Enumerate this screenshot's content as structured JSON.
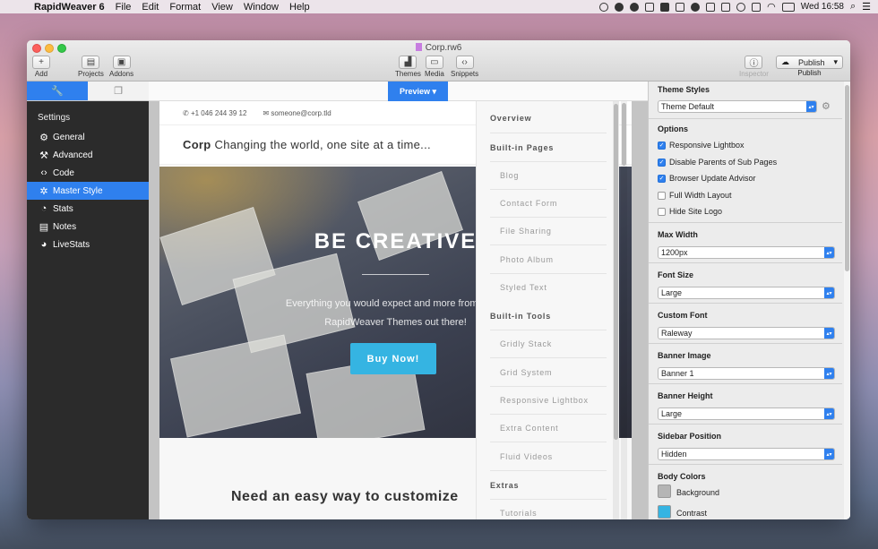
{
  "menubar": {
    "apple": "",
    "app": "RapidWeaver 6",
    "menus": [
      "File",
      "Edit",
      "Format",
      "View",
      "Window",
      "Help"
    ],
    "clock": "Wed 16:58"
  },
  "window": {
    "title": "Corp.rw6",
    "toolbar": {
      "add": "Add",
      "projects": "Projects",
      "addons": "Addons",
      "themes": "Themes",
      "media": "Media",
      "snippets": "Snippets",
      "inspector": "Inspector",
      "publish_button": "Publish",
      "publish_label": "Publish"
    }
  },
  "sidebar": {
    "section_label": "Settings",
    "items": [
      {
        "label": "General",
        "icon": "gear-icon"
      },
      {
        "label": "Advanced",
        "icon": "wrench-icon"
      },
      {
        "label": "Code",
        "icon": "code-icon"
      },
      {
        "label": "Master Style",
        "icon": "magic-wand-icon"
      },
      {
        "label": "Stats",
        "icon": "stats-icon"
      },
      {
        "label": "Notes",
        "icon": "notes-icon"
      },
      {
        "label": "LiveStats",
        "icon": "livestats-icon"
      }
    ],
    "active_index": 3
  },
  "preview": {
    "button": "Preview ▾",
    "phone": "+1 046 244 39 12",
    "email": "someone@corp.tld",
    "brand": "Corp",
    "tagline": "Changing the world, one site at a time...",
    "hero_title": "BE CREATIVE",
    "hero_sub_1": "Everything you would expect and more from one o",
    "hero_sub_2": "RapidWeaver Themes out there!",
    "buy_button": "Buy Now!",
    "section_title": "Need an easy way to customize",
    "section_sub": ""
  },
  "nav_panel": {
    "overview": "Overview",
    "builtin_pages": "Built-in Pages",
    "pages": [
      "Blog",
      "Contact Form",
      "File Sharing",
      "Photo Album",
      "Styled Text"
    ],
    "builtin_tools": "Built-in Tools",
    "tools": [
      "Gridly Stack",
      "Grid System",
      "Responsive Lightbox",
      "Extra Content",
      "Fluid Videos"
    ],
    "extras": "Extras",
    "extras_items": [
      "Tutorials"
    ]
  },
  "inspector": {
    "theme_styles": {
      "label": "Theme Styles",
      "value": "Theme Default"
    },
    "options": {
      "label": "Options",
      "items": [
        {
          "label": "Responsive Lightbox",
          "checked": true
        },
        {
          "label": "Disable Parents of Sub Pages",
          "checked": true
        },
        {
          "label": "Browser Update Advisor",
          "checked": true
        },
        {
          "label": "Full Width Layout",
          "checked": false
        },
        {
          "label": "Hide Site Logo",
          "checked": false
        }
      ]
    },
    "max_width": {
      "label": "Max Width",
      "value": "1200px"
    },
    "font_size": {
      "label": "Font Size",
      "value": "Large"
    },
    "custom_font": {
      "label": "Custom Font",
      "value": "Raleway"
    },
    "banner_image": {
      "label": "Banner Image",
      "value": "Banner 1"
    },
    "banner_height": {
      "label": "Banner Height",
      "value": "Large"
    },
    "sidebar_position": {
      "label": "Sidebar Position",
      "value": "Hidden"
    },
    "body_colors": {
      "label": "Body Colors",
      "items": [
        {
          "label": "Background",
          "color": "#b5b5b5"
        },
        {
          "label": "Contrast",
          "color": "#35b4e2"
        }
      ]
    }
  },
  "colors": {
    "accent": "#2f80ee",
    "button": "#35b4e2"
  }
}
